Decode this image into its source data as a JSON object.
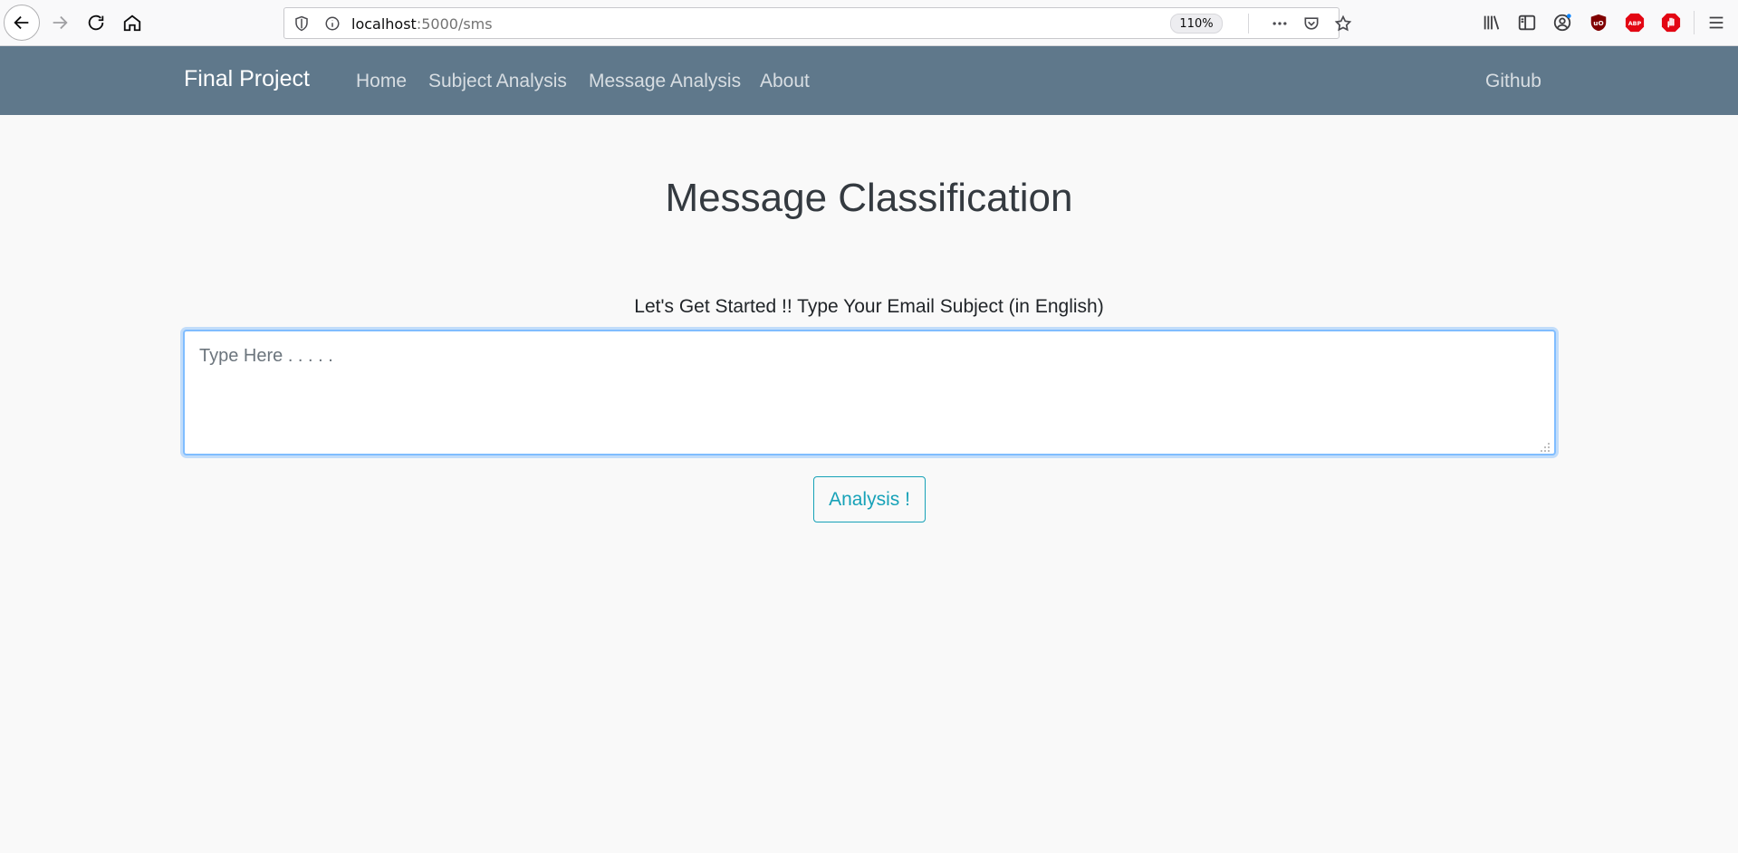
{
  "browser": {
    "url_host": "localhost",
    "url_path": ":5000/sms",
    "zoom": "110%"
  },
  "navbar": {
    "brand": "Final Project",
    "links": [
      "Home",
      "Subject Analysis",
      "Message Analysis",
      "About"
    ],
    "right_link": "Github",
    "background": "#5f788b"
  },
  "main": {
    "title": "Message Classification",
    "prompt": "Let's Get Started !! Type Your Email Subject (in English)",
    "input_placeholder": "Type Here . . . . .",
    "input_value": "",
    "submit_label": "Analysis !"
  },
  "colors": {
    "accent": "#17a2b8",
    "focus": "#80bdff"
  }
}
